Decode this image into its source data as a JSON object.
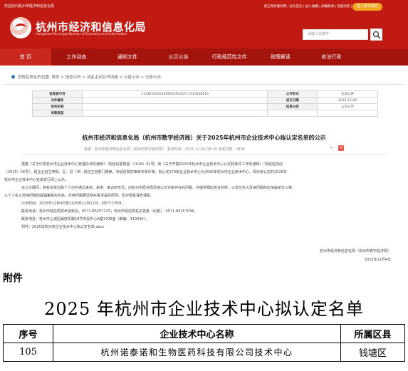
{
  "header": {
    "welcome": "欢迎访问杭州市经济和信息化局",
    "top_links": "浙江政务服务网 | 设为首页 | 加入收藏 | 加载新闻 | 智能问答 | 登录",
    "elder_mode": "进入老年模式",
    "site_title": "杭州市经济和信息化局",
    "site_title_en": "Hangzhou Municipal Bureau of Economy and Information",
    "search_placeholder": "请输入关键字"
  },
  "nav": {
    "items": [
      "首 页",
      "工作动态",
      "通知文件",
      "公示公告",
      "行政规范性文件",
      "政策解读",
      "依法行政"
    ]
  },
  "breadcrumb": "您现在所在的位置: 首页 > 信息公开 > 法定主动公开内容 > 公告公示 > 公告公示",
  "info": {
    "rows": [
      {
        "k1": "信息索引号",
        "v1": "113301000024894529/2025-1010436014",
        "k2": "公开形式",
        "v2": "主动公开"
      },
      {
        "k1": "文件编号",
        "v1": "",
        "k2": "成文日期",
        "v2": "2025-12-04"
      },
      {
        "k1": "发布机构",
        "v1": "",
        "k2": "信息分类",
        "v2": "公告公示"
      },
      {
        "k1": "关联类型",
        "v1": "",
        "k2": "",
        "v2": ""
      }
    ]
  },
  "article": {
    "title": "杭州市经济和信息化局（杭州市数字经济局）关于2025年杭州市企业技术中心拟认定名单的公示",
    "meta": "来源：杭州市经济和信息化局（杭州市数字经济局）      发布时间：2025-12-04 09:19      浏览次数：1806",
    "paragraphs": [
      "根据《关于印发杭州市企业技术中心管理办法的通知》（杭经信联督能〔2018〕81号）和《关于开展2025年杭州市企业技术中心认定和复评工作的通知》（杭经信技创",
      "〔2025〕56号），经企业自主申报、区、县（市）经信主管部门推荐，市经信局初审和专家评审，拟认定170家企业技术中心为2025年杭州市企业技术中心，现对拟认定的2025年",
      "杭州市企业技术中心名单进行网上公示。",
      "在公示期间，各有关单位和个人均可通过来信、来电、来访的形式，向杭州市经信局反映公示对象存在的问题，并提供相应佐证材料，以单位名义反映问题的应加盖单位公章，",
      "以个人名义反映问题的提倡署真实姓名。反映问题要坚持实事求是的原则，反对借机诬告诬陷。",
      "公示时间：2025年12月4日至2025年12月11日，共5个工作日。",
      "联系电话：杭州市经信局技术创新处，0571-85257133；杭州市经信局机关党委（纪委），0571-85257036。",
      "联系地址：杭州市上城区解放东路18号市民中心A座1706室（邮编：310000）。",
      "附件：2025年杭州市企业技术中心拟认定名单.docx"
    ],
    "sign_org": "杭州市经济和信息化局（杭州市数字经济局）",
    "sign_date": "2025年12月4日"
  },
  "attachment": {
    "label": "附件",
    "title": "2025 年杭州市企业技术中心拟认定名单",
    "columns": [
      "序号",
      "企业技术中心名称",
      "所属区县"
    ],
    "rows": [
      {
        "no": "105",
        "name": "杭州诺泰诺和生物医药科技有限公司技术中心",
        "district": "钱塘区"
      }
    ]
  },
  "colors": {
    "brand_red": "#c01a12",
    "nav_red": "#a4140d",
    "elder_orange": "#f2a51e"
  }
}
